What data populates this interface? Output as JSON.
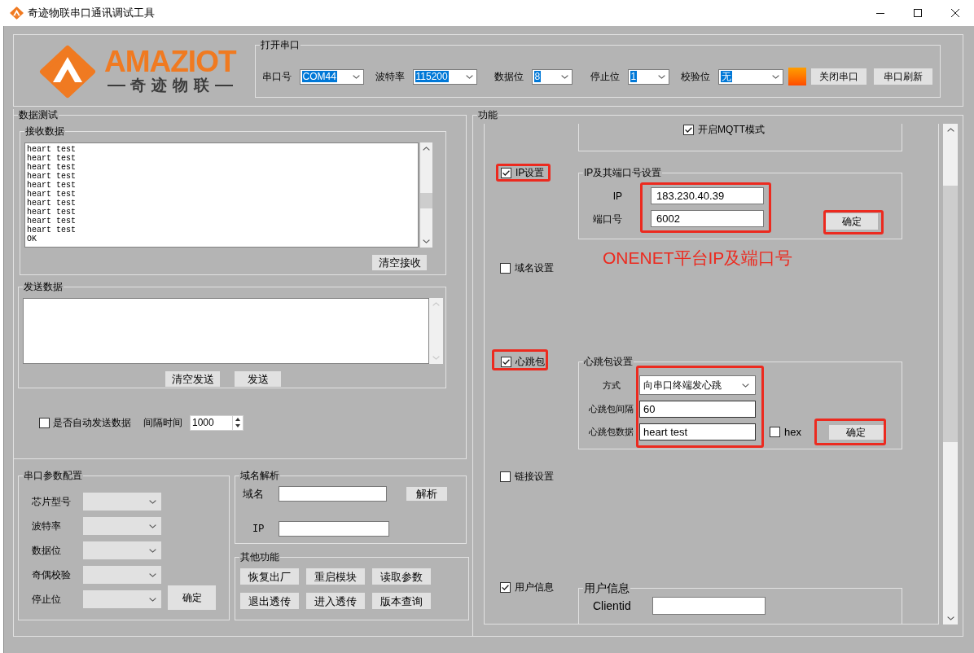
{
  "window": {
    "title": "奇迹物联串口通讯调试工具"
  },
  "logo": {
    "wordmark": "AMAZIOT",
    "tagline": "奇迹物联"
  },
  "serial_port": {
    "title": "打开串口",
    "fields": [
      {
        "label": "串口号",
        "value": "COM44"
      },
      {
        "label": "波特率",
        "value": "115200"
      },
      {
        "label": "数据位",
        "value": "8"
      },
      {
        "label": "停止位",
        "value": "1"
      },
      {
        "label": "校验位",
        "value": "无"
      }
    ],
    "open": true,
    "buttons": [
      "关闭串口",
      "串口刷新"
    ]
  },
  "data_test": {
    "title": "数据测试",
    "receive": {
      "title": "接收数据",
      "lines": [
        "heart test",
        "heart test",
        "heart test",
        "heart test",
        "heart test",
        "heart test",
        "heart test",
        "heart test",
        "heart test",
        "heart test",
        "OK"
      ],
      "button": "清空接收"
    },
    "send": {
      "title": "发送数据",
      "buttons": [
        "清空发送",
        "发送"
      ]
    },
    "auto_send": {
      "label": "是否自动发送数据",
      "checked": false,
      "interval_label": "间隔时间",
      "interval": "1000"
    }
  },
  "serial_config": {
    "title": "串口参数配置",
    "fields": [
      "芯片型号",
      "波特率",
      "数据位",
      "奇偶校验",
      "停止位"
    ],
    "button": "确定"
  },
  "dns": {
    "title": "域名解析",
    "domain_label": "域名",
    "ip_label": "IP",
    "button": "解析"
  },
  "other_functions": {
    "title": "其他功能",
    "buttons": [
      "恢复出厂",
      "重启模块",
      "读取参数",
      "退出透传",
      "进入透传",
      "版本查询"
    ]
  },
  "functions": {
    "title": "功能",
    "mqtt": {
      "label": "开启MQTT模式",
      "checked": true
    },
    "ip": {
      "label": "IP设置",
      "checked": true,
      "highlighted": true,
      "group": {
        "title": "IP及其端口号设置",
        "fields": [
          {
            "label": "IP",
            "value": "183.230.40.39"
          },
          {
            "label": "端口号",
            "value": "6002"
          }
        ],
        "fields_highlighted": true,
        "button": {
          "label": "确定",
          "highlighted": true
        }
      }
    },
    "note": "ONENET平台IP及端口号",
    "domain": {
      "label": "域名设置",
      "checked": false
    },
    "heartbeat": {
      "label": "心跳包",
      "checked": true,
      "highlighted": true,
      "group": {
        "title": "心跳包设置",
        "fields": [
          {
            "kind": "select",
            "label": "方式",
            "value": "向串口终端发心跳"
          },
          {
            "kind": "text",
            "label": "心跳包间隔",
            "value": "60"
          },
          {
            "kind": "text",
            "label": "心跳包数据",
            "value": "heart test"
          }
        ],
        "fields_highlighted": true,
        "hex": {
          "label": "hex",
          "checked": false
        },
        "button": {
          "label": "确定",
          "highlighted": true
        }
      }
    },
    "link": {
      "label": "链接设置",
      "checked": false
    },
    "user_info": {
      "label": "用户信息",
      "checked": true,
      "group": {
        "title": "用户信息",
        "fields": [
          {
            "label": "Clientid"
          }
        ]
      }
    }
  }
}
